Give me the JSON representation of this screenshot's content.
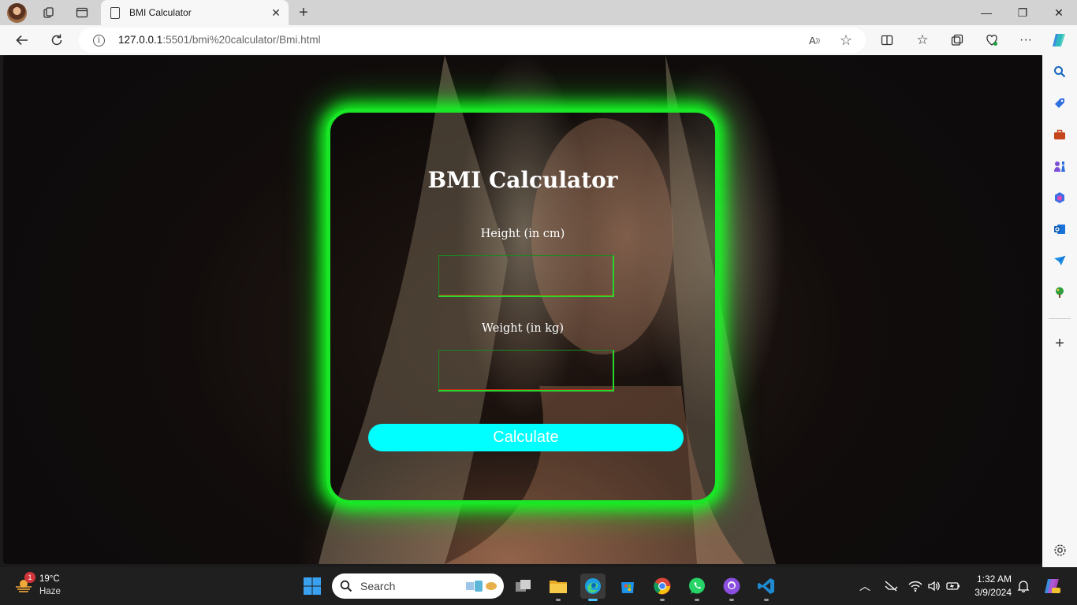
{
  "browser": {
    "tab": {
      "title": "BMI Calculator",
      "close_icon": "✕"
    },
    "new_tab_icon": "+",
    "window_controls": {
      "minimize": "—",
      "restore": "❐",
      "close": "✕"
    },
    "address": {
      "host": "127.0.0.1",
      "path": ":5501/bmi%20calculator/Bmi.html"
    }
  },
  "page": {
    "title": "BMI Calculator",
    "height_label": "Height (in cm)",
    "weight_label": "Weight (in kg)",
    "height_value": "",
    "weight_value": "",
    "button_label": "Calculate",
    "colors": {
      "glow": "#19e626",
      "button": "#00ffff"
    }
  },
  "taskbar": {
    "weather": {
      "temp": "19°C",
      "desc": "Haze",
      "badge": "1"
    },
    "search_placeholder": "Search",
    "clock": {
      "time": "1:32 AM",
      "date": "3/9/2024"
    }
  }
}
